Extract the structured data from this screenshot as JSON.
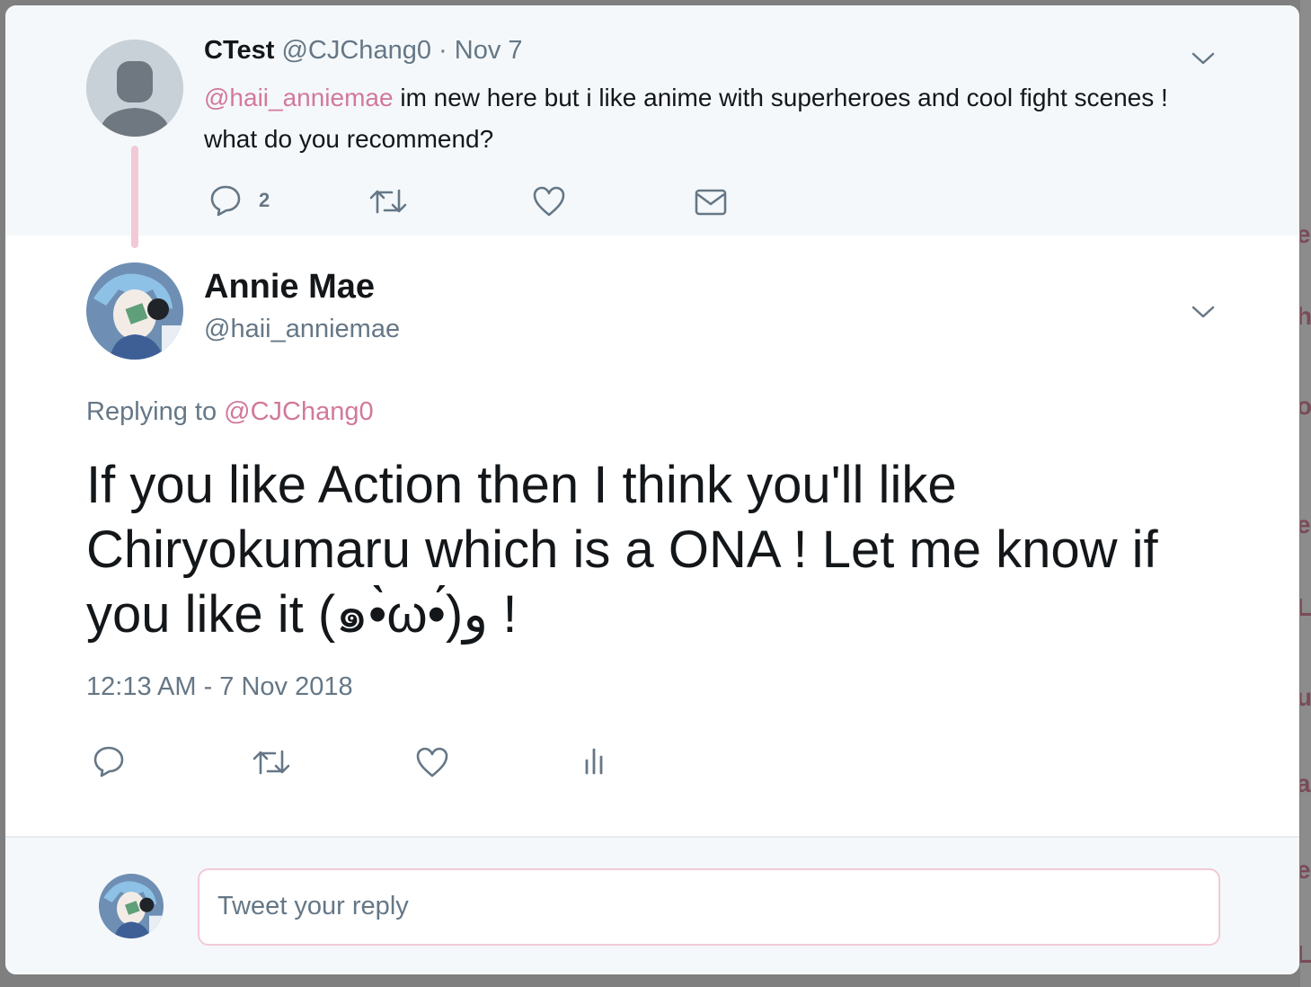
{
  "parent_tweet": {
    "display_name": "CTest",
    "handle": "@CJChang0",
    "separator": "·",
    "date": "Nov 7",
    "mention": "@haii_anniemae",
    "text": " im new here but i like anime with superheroes and cool fight scenes ! what do you recommend?",
    "reply_count": "2"
  },
  "main_tweet": {
    "display_name": "Annie Mae",
    "handle": "@haii_anniemae",
    "replying_prefix": "Replying to ",
    "replying_handle": "@CJChang0",
    "text": "If you like Action then I think you'll like Chiryokumaru which is a ONA ! Let me know if you like it (๑•̀ω•́)و !",
    "timestamp": "12:13 AM - 7 Nov 2018"
  },
  "reply_box": {
    "placeholder": "Tweet your reply"
  },
  "colors": {
    "accent": "#d2799b",
    "muted": "#657786",
    "thread_line": "#f2c9d6",
    "text": "#14171a"
  },
  "icons": [
    "reply-icon",
    "retweet-icon",
    "like-icon",
    "message-icon",
    "analytics-icon",
    "chevron-down-icon"
  ]
}
